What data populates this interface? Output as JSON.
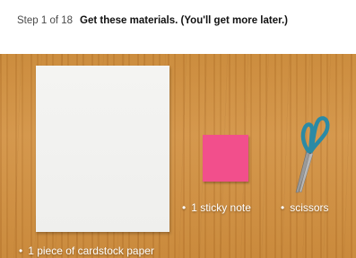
{
  "header": {
    "step_count": "Step 1 of 18",
    "step_title": "Get these materials. (You'll get more later.)"
  },
  "materials": [
    {
      "bullet": "•",
      "label": "1 sticky note"
    },
    {
      "bullet": "•",
      "label": "scissors"
    },
    {
      "bullet": "•",
      "label": "1 piece of cardstock paper"
    }
  ],
  "colors": {
    "wood": "#c98a3c",
    "paper": "#f1f1ef",
    "sticky_note": "#f24f8c",
    "scissors_handle": "#2b8aa5"
  }
}
